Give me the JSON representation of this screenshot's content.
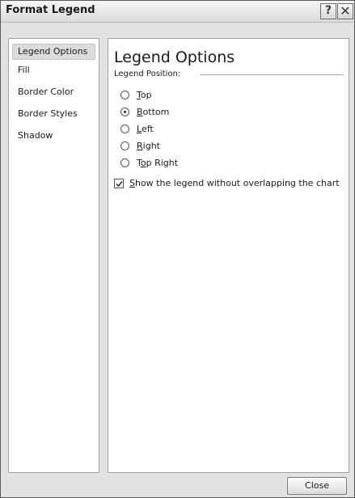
{
  "window": {
    "title": "Format Legend",
    "help_label": "?",
    "close_label": "✕"
  },
  "sidebar": {
    "items": [
      {
        "label": "Legend Options",
        "selected": true
      },
      {
        "label": "Fill",
        "selected": false
      },
      {
        "label": "Border Color",
        "selected": false
      },
      {
        "label": "Border Styles",
        "selected": false
      },
      {
        "label": "Shadow",
        "selected": false
      }
    ]
  },
  "main": {
    "heading": "Legend Options",
    "group_label": "Legend Position:",
    "positions": [
      {
        "label": "Top",
        "access_key": "T",
        "rest": "op",
        "checked": false
      },
      {
        "label": "Bottom",
        "access_key": "B",
        "rest": "ottom",
        "checked": true
      },
      {
        "label": "Left",
        "access_key": "L",
        "rest": "eft",
        "checked": false
      },
      {
        "label": "Right",
        "access_key": "R",
        "rest": "ight",
        "checked": false
      },
      {
        "label": "Top Right",
        "prefix": "T",
        "access_key": "o",
        "rest": "p Right",
        "checked": false
      }
    ],
    "overlap_checkbox": {
      "label": "Show the legend without overlapping the chart",
      "access_key": "S",
      "rest": "how the legend without overlapping the chart",
      "checked": true
    }
  },
  "footer": {
    "close_button": "Close"
  }
}
